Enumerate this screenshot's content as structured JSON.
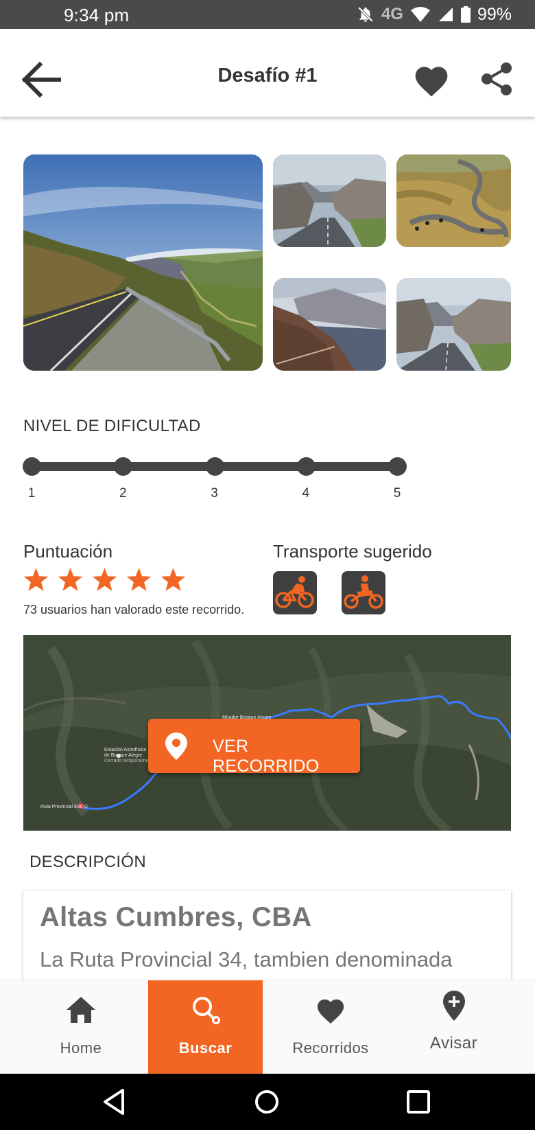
{
  "status_bar": {
    "time": "9:34 pm",
    "network": "4G",
    "battery": "99%",
    "icons": [
      "bell-off-icon",
      "wifi-icon",
      "signal-icon",
      "battery-icon"
    ]
  },
  "app_bar": {
    "title": "Desafío #1",
    "icons": [
      "back-arrow-icon",
      "heart-icon",
      "share-icon"
    ]
  },
  "gallery": {
    "photo_count": 5
  },
  "difficulty": {
    "label": "NIVEL DE DIFICULTAD",
    "levels": [
      "1",
      "2",
      "3",
      "4",
      "5"
    ]
  },
  "rating": {
    "label": "Puntuación",
    "stars": 5,
    "note": "73 usuarios han valorado este recorrido."
  },
  "transport": {
    "label": "Transporte sugerido",
    "options": [
      "bicycle-icon",
      "motorcycle-icon"
    ]
  },
  "map": {
    "button_label": "VER RECORRIDO",
    "labels": {
      "observatory_line1": "Estación Astrofísica",
      "observatory_line2": "de Bosque Alegre",
      "observatory_line3": "Cerrado temporalmente",
      "route_start": "Ruta Provincial E96 O",
      "place": "Mirador Bosque Alegre"
    }
  },
  "description": {
    "label": "DESCRIPCIÓN",
    "title": "Altas Cumbres, CBA",
    "body": "La Ruta Provincial 34, tambien denominada"
  },
  "bottom_nav": {
    "items": [
      {
        "label": "Home",
        "icon": "home-icon",
        "active": false
      },
      {
        "label": "Buscar",
        "icon": "search-icon",
        "active": true
      },
      {
        "label": "Recorridos",
        "icon": "heart-icon",
        "active": false
      },
      {
        "label": "Avisar",
        "icon": "add-location-icon",
        "active": false
      }
    ]
  },
  "colors": {
    "accent": "#f26522",
    "status_bar": "#4a4a4a",
    "dark_icon": "#3f3f3f",
    "text_dark": "#333333",
    "text_muted": "#757575"
  }
}
